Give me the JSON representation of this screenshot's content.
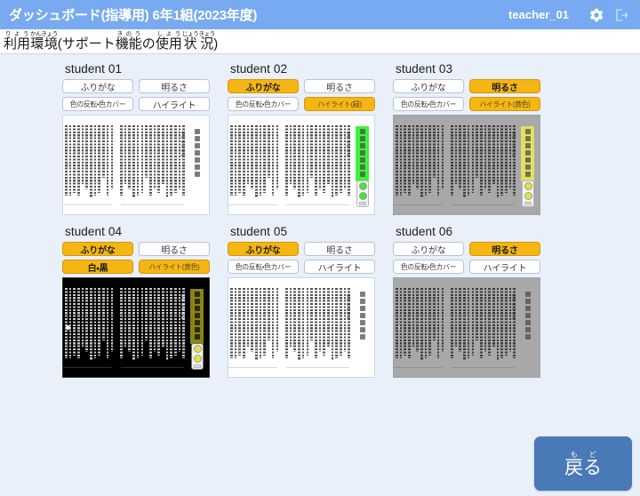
{
  "topbar": {
    "title": "ダッシュボード(指導用) 6年1組(2023年度)",
    "user": "teacher_01",
    "settings_icon": "gear-icon",
    "logout_icon": "logout-icon"
  },
  "subheader": {
    "text_main_1": "利用",
    "ruby_1": "りよう",
    "text_main_2": "環境",
    "ruby_2": "かんきょう",
    "text_plain_1": "(サポート",
    "text_main_3": "機能",
    "ruby_3": "きのう",
    "text_plain_2": "の",
    "text_main_4": "使用",
    "ruby_4": "しよう",
    "text_main_5": "状",
    "ruby_5": "じょう",
    "text_main_6": "況",
    "ruby_6": "きょう",
    "text_plain_3": ")",
    "full_text": "利用環境(サポート機能の使用状況)"
  },
  "buttons": {
    "furigana": "ふりがな",
    "brightness": "明るさ",
    "invert_default": "色の反転・色カバー",
    "invert_bw": "白・黒",
    "highlight_default": "ハイライト",
    "highlight_green": "ハイライト(緑)",
    "highlight_yellow": "ハイライト(黄色)"
  },
  "colors": {
    "topbar": "#77aaf0",
    "page_bg": "#e9f0fa",
    "active_button": "#f5b613",
    "back_button": "#4a79b8",
    "highlight_green": "#3cf43c",
    "highlight_yellow": "#e3dd63",
    "highlight_dark": "#8c8410"
  },
  "students": [
    {
      "name": "student 01",
      "btn_furigana": {
        "label": "ふりがな",
        "active": false,
        "small": false
      },
      "btn_brightness": {
        "label": "明るさ",
        "active": false,
        "small": false
      },
      "btn_invert": {
        "label": "色の反転・色カバー",
        "active": false,
        "small": true
      },
      "btn_highlight": {
        "label": "ハイライト",
        "active": false,
        "small": false
      },
      "preview_mode": "normal",
      "highlight_band": "none",
      "widget": "none"
    },
    {
      "name": "student 02",
      "btn_furigana": {
        "label": "ふりがな",
        "active": true,
        "small": false
      },
      "btn_brightness": {
        "label": "明るさ",
        "active": false,
        "small": false
      },
      "btn_invert": {
        "label": "色の反転・色カバー",
        "active": false,
        "small": true
      },
      "btn_highlight": {
        "label": "ハイライト(緑)",
        "active": true,
        "small": true
      },
      "preview_mode": "normal",
      "highlight_band": "green",
      "widget": "green"
    },
    {
      "name": "student 03",
      "btn_furigana": {
        "label": "ふりがな",
        "active": false,
        "small": false
      },
      "btn_brightness": {
        "label": "明るさ",
        "active": true,
        "small": false
      },
      "btn_invert": {
        "label": "色の反転・色カバー",
        "active": false,
        "small": true
      },
      "btn_highlight": {
        "label": "ハイライト(黄色)",
        "active": true,
        "small": true
      },
      "preview_mode": "dim",
      "highlight_band": "yellow",
      "widget": "yellow"
    },
    {
      "name": "student 04",
      "btn_furigana": {
        "label": "ふりがな",
        "active": true,
        "small": false
      },
      "btn_brightness": {
        "label": "明るさ",
        "active": false,
        "small": false
      },
      "btn_invert": {
        "label": "白・黒",
        "active": true,
        "small": false
      },
      "btn_highlight": {
        "label": "ハイライト(黄色)",
        "active": true,
        "small": true
      },
      "preview_mode": "invert",
      "highlight_band": "dark",
      "widget": "yellow"
    },
    {
      "name": "student 05",
      "btn_furigana": {
        "label": "ふりがな",
        "active": true,
        "small": false
      },
      "btn_brightness": {
        "label": "明るさ",
        "active": false,
        "small": false
      },
      "btn_invert": {
        "label": "色の反転・色カバー",
        "active": false,
        "small": true
      },
      "btn_highlight": {
        "label": "ハイライト",
        "active": false,
        "small": false
      },
      "preview_mode": "normal",
      "highlight_band": "none",
      "widget": "none"
    },
    {
      "name": "student 06",
      "btn_furigana": {
        "label": "ふりがな",
        "active": false,
        "small": false
      },
      "btn_brightness": {
        "label": "明るさ",
        "active": true,
        "small": false
      },
      "btn_invert": {
        "label": "色の反転・色カバー",
        "active": false,
        "small": true
      },
      "btn_highlight": {
        "label": "ハイライト",
        "active": false,
        "small": false
      },
      "preview_mode": "dim",
      "highlight_band": "none",
      "widget": "none"
    }
  ],
  "back_button": {
    "label": "戻る",
    "ruby": "もど"
  }
}
